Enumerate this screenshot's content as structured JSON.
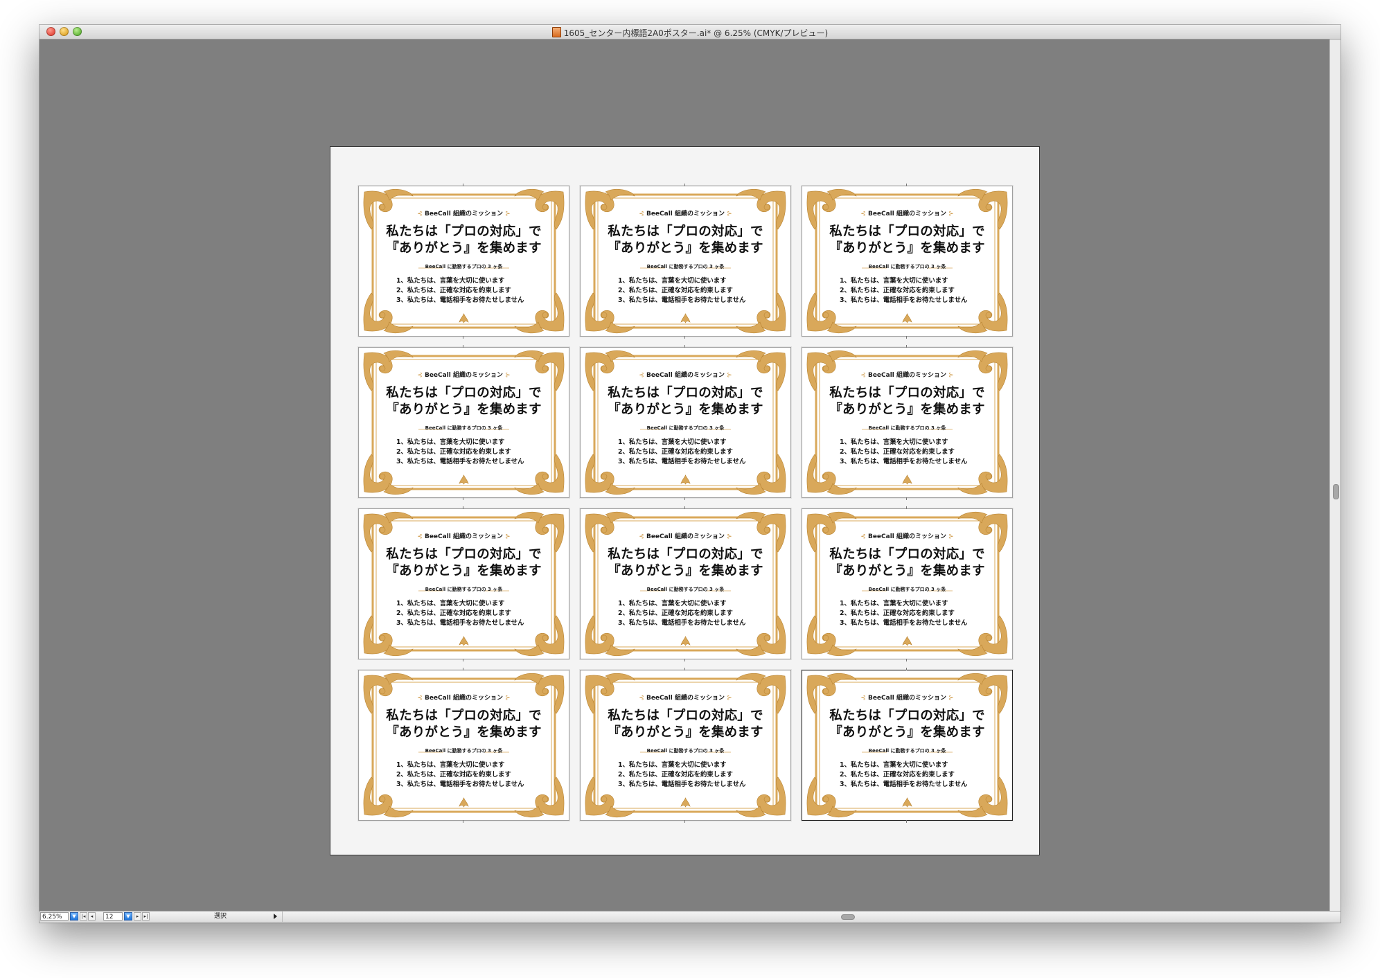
{
  "window": {
    "title": "1605_センター内標語2A0ポスター.ai* @ 6.25% (CMYK/プレビュー)"
  },
  "statusbar": {
    "zoom": "6.25%",
    "page": "12",
    "mode_label": "選択"
  },
  "card": {
    "mission": "BeeCall 組織のミッション",
    "mission_ornament_left": "⊰",
    "mission_ornament_right": "⊱",
    "headline_line1": "私たちは「プロの対応」で",
    "headline_line2": "『ありがとう』を集めます",
    "subheading": "BeeCall に勤務するプロの 3 ヶ条",
    "rules": [
      "1、私たちは、言葉を大切に使います",
      "2、私たちは、正確な対応を約束します",
      "3、私たちは、電話相手をお待たせしません"
    ],
    "bottom_ornament": "❦"
  },
  "colors": {
    "frame_gold": "#d9a85a",
    "frame_gold_dark": "#b98534",
    "canvas": "#7f7f7f",
    "artboard": "#f4f4f4"
  }
}
